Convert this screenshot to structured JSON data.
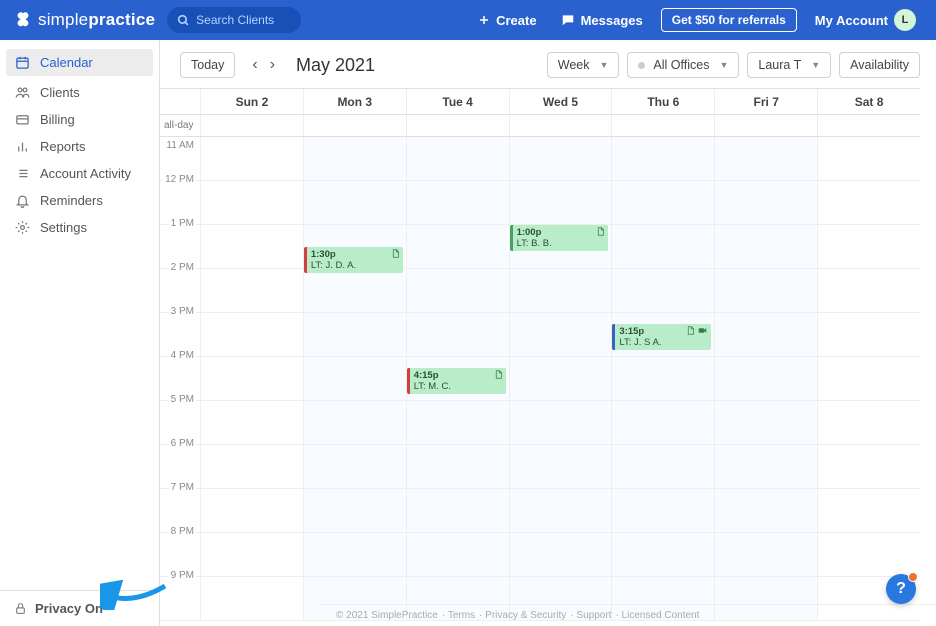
{
  "header": {
    "brand_light": "simple",
    "brand_bold": "practice",
    "search_placeholder": "Search Clients",
    "create_label": "Create",
    "messages_label": "Messages",
    "referral_label": "Get $50 for referrals",
    "account_label": "My Account",
    "avatar_initial": "L"
  },
  "sidebar": {
    "items": [
      {
        "label": "Calendar",
        "icon": "calendar"
      },
      {
        "label": "Clients",
        "icon": "people"
      },
      {
        "label": "Billing",
        "icon": "card"
      },
      {
        "label": "Reports",
        "icon": "bar-chart"
      },
      {
        "label": "Account Activity",
        "icon": "list"
      },
      {
        "label": "Reminders",
        "icon": "bell"
      },
      {
        "label": "Settings",
        "icon": "gear"
      }
    ],
    "privacy_label": "Privacy On"
  },
  "toolbar": {
    "today": "Today",
    "month": "May 2021",
    "view": "Week",
    "offices": "All Offices",
    "clinician": "Laura T",
    "availability": "Availability"
  },
  "calendar": {
    "allday_label": "all-day",
    "days": [
      "Sun 2",
      "Mon 3",
      "Tue 4",
      "Wed 5",
      "Thu 6",
      "Fri 7",
      "Sat 8"
    ],
    "hours": [
      "11 AM",
      "12 PM",
      "1 PM",
      "2 PM",
      "3 PM",
      "4 PM",
      "5 PM",
      "6 PM",
      "7 PM",
      "8 PM",
      "9 PM"
    ],
    "events": [
      {
        "day": 1,
        "hour_offset": 2.5,
        "time": "1:30p",
        "who": "LT: J. D. A.",
        "icons": [
          "doc"
        ],
        "bar": "red"
      },
      {
        "day": 3,
        "hour_offset": 2.0,
        "time": "1:00p",
        "who": "LT: B. B.",
        "icons": [
          "doc"
        ],
        "bar": "green"
      },
      {
        "day": 2,
        "hour_offset": 5.25,
        "time": "4:15p",
        "who": "LT: M. C.",
        "icons": [
          "doc"
        ],
        "bar": "red"
      },
      {
        "day": 4,
        "hour_offset": 4.25,
        "time": "3:15p",
        "who": "LT: J. S A.",
        "icons": [
          "doc",
          "video"
        ],
        "bar": "blue"
      }
    ]
  },
  "footer": {
    "copyright": "© 2021 SimplePractice",
    "links": [
      "Terms",
      "Privacy & Security",
      "Support",
      "Licensed Content"
    ]
  },
  "help": {
    "glyph": "?"
  }
}
